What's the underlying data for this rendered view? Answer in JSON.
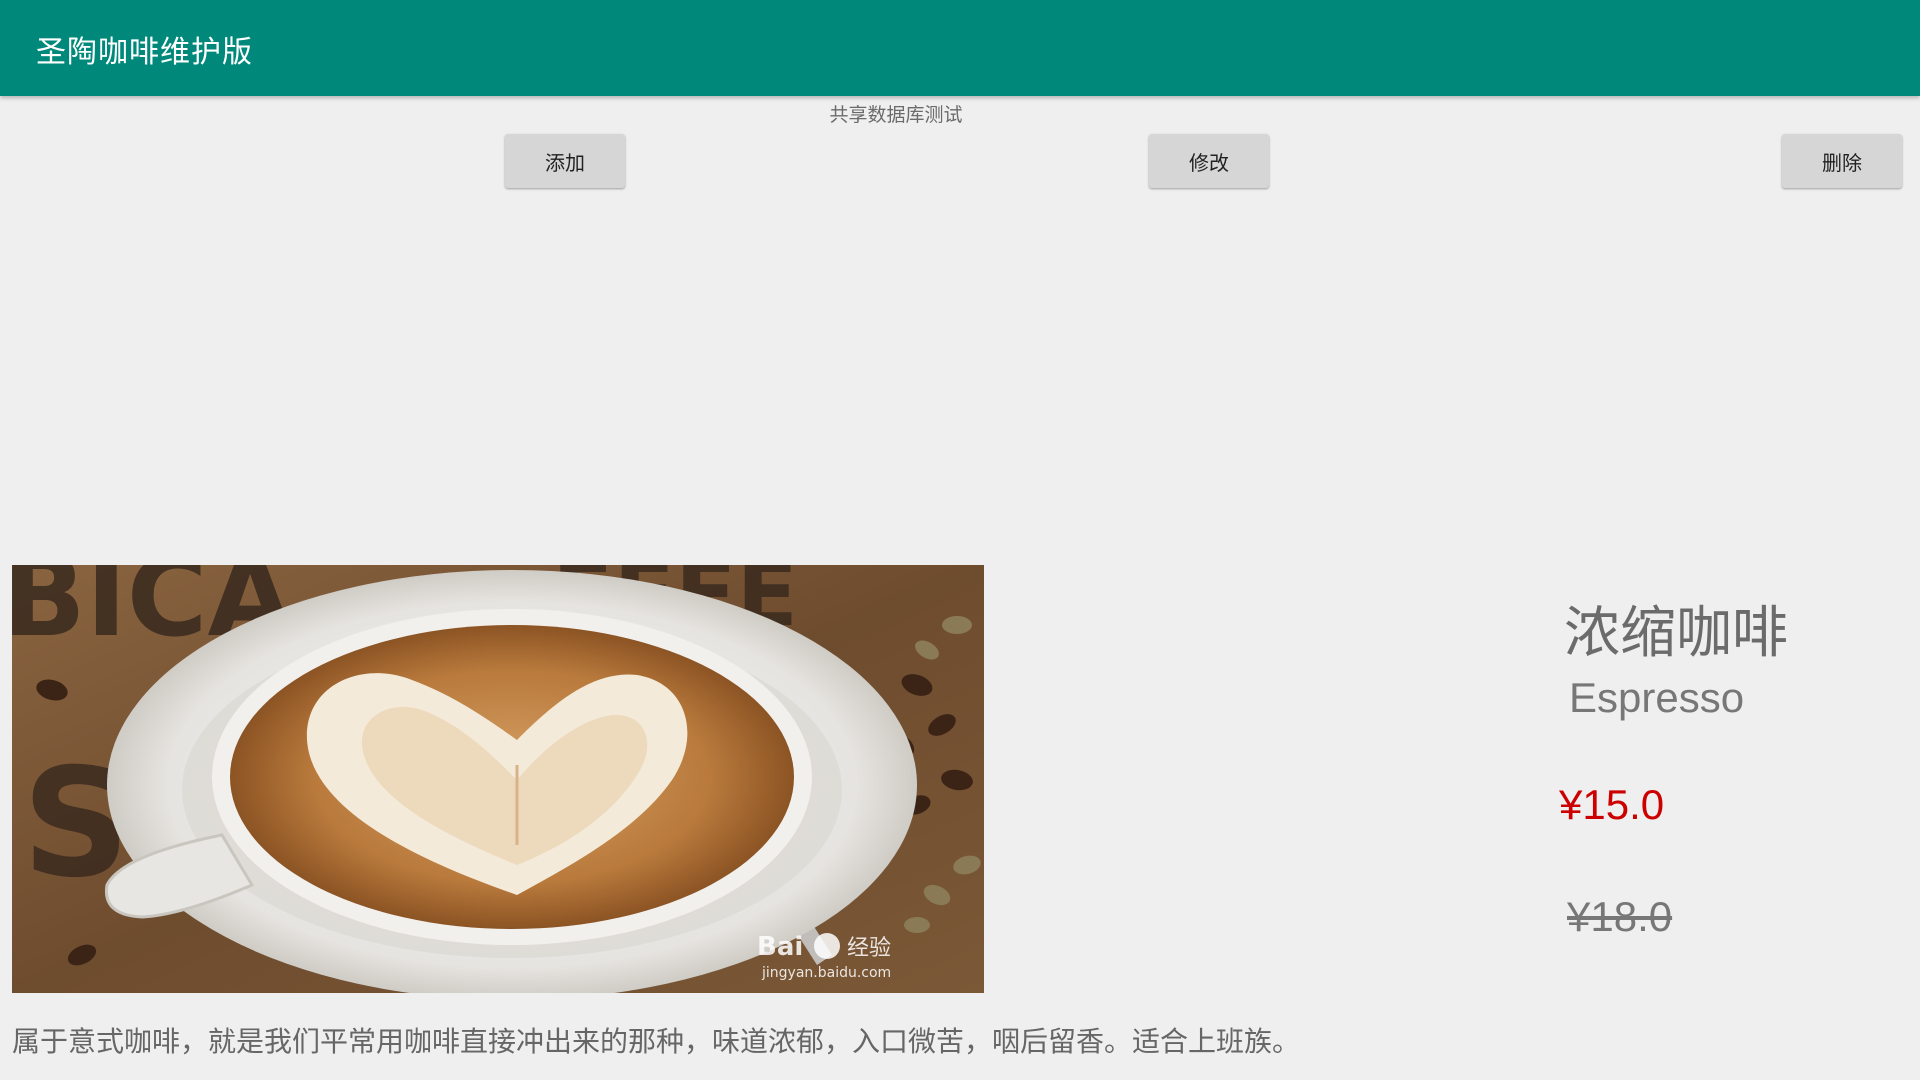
{
  "app": {
    "title": "圣陶咖啡维护版",
    "accent_color": "#00897b"
  },
  "db_section": {
    "label": "共享数据库测试"
  },
  "actions": {
    "add_label": "添加",
    "edit_label": "修改",
    "delete_label": "删除"
  },
  "product": {
    "image_icon": "coffee-latte-art-image",
    "image_watermark": "Bai du 经验 jingyan.baidu.com",
    "name_cn": "浓缩咖啡",
    "name_en": "Espresso",
    "price_current": "¥15.0",
    "price_current_color": "#cc0000",
    "price_original": "¥18.0",
    "description": "属于意式咖啡，就是我们平常用咖啡直接冲出来的那种，味道浓郁，入口微苦，咽后留香。适合上班族。"
  }
}
